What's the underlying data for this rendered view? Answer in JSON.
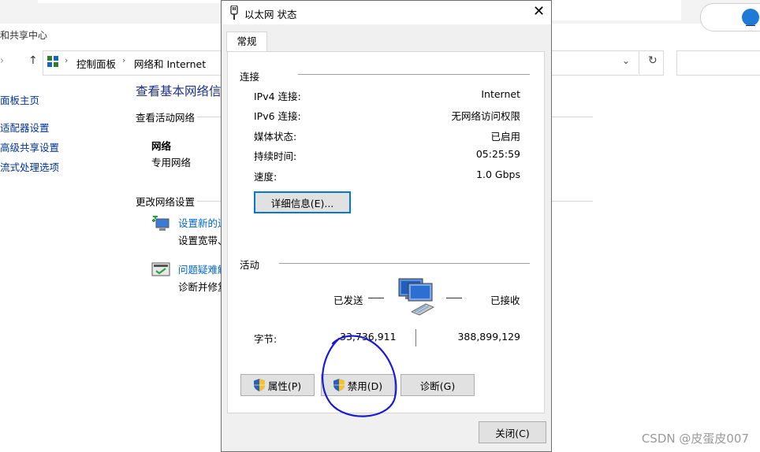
{
  "window": {
    "title": "和共享中心",
    "breadcrumb": [
      "控制面板",
      "网络和 Internet"
    ]
  },
  "sidebar": {
    "items": [
      {
        "label": "面板主页"
      },
      {
        "label": "适配器设置"
      },
      {
        "label": "高级共享设置"
      },
      {
        "label": "流式处理选项"
      }
    ]
  },
  "main": {
    "title": "查看基本网络信",
    "active_section": "查看活动网络",
    "network_name": "网络",
    "network_type": "专用网络",
    "change_section": "更改网络设置",
    "tasks": [
      {
        "link": "设置新的连",
        "desc": "设置宽带、"
      },
      {
        "link": "问题疑难解",
        "desc": "诊断并修复"
      }
    ]
  },
  "dialog": {
    "title": "以太网 状态",
    "tab": "常规",
    "connection": {
      "label": "连接",
      "rows": [
        {
          "label": "IPv4 连接:",
          "value": "Internet"
        },
        {
          "label": "IPv6 连接:",
          "value": "无网络访问权限"
        },
        {
          "label": "媒体状态:",
          "value": "已启用"
        },
        {
          "label": "持续时间:",
          "value": "05:25:59"
        },
        {
          "label": "速度:",
          "value": "1.0 Gbps"
        }
      ],
      "details_button": "详细信息(E)..."
    },
    "activity": {
      "label": "活动",
      "sent_label": "已发送",
      "received_label": "已接收",
      "bytes_label": "字节:",
      "bytes_sent": "33,736,911",
      "bytes_received": "388,899,129"
    },
    "buttons": {
      "properties": "属性(P)",
      "disable": "禁用(D)",
      "diagnose": "诊断(G)",
      "close": "关闭(C)"
    }
  },
  "watermark": "CSDN @皮蛋皮007",
  "colors": {
    "link": "#0066cc",
    "annotation": "#1a1ad6",
    "focus": "#0078d7"
  }
}
